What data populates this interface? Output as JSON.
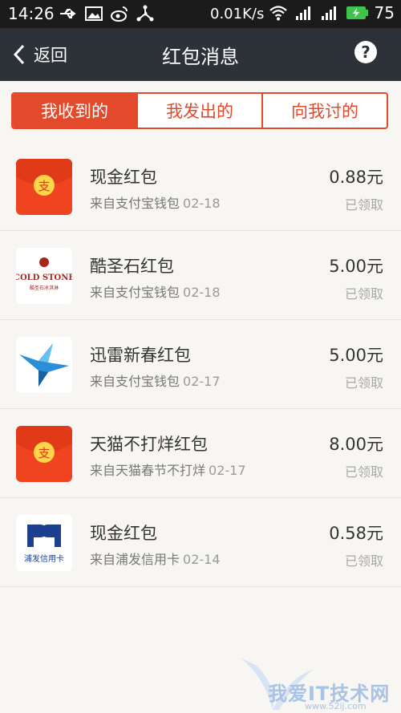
{
  "status_bar": {
    "time": "14:26",
    "speed": "0.01K/s",
    "battery": "75",
    "icons": [
      "usb-icon",
      "image-icon",
      "weibo-icon",
      "share-icon",
      "wifi-icon",
      "signal-icon",
      "battery-icon"
    ]
  },
  "nav": {
    "back_label": "返回",
    "title": "红包消息",
    "help_label": "?"
  },
  "tabs": [
    {
      "label": "我收到的",
      "active": true
    },
    {
      "label": "我发出的",
      "active": false
    },
    {
      "label": "向我讨的",
      "active": false
    }
  ],
  "items": [
    {
      "title": "现金红包",
      "source": "来自支付宝钱包",
      "date": "02-18",
      "amount": "0.88元",
      "status": "已领取",
      "icon": "alipay-redpacket-icon",
      "icon_char": "支"
    },
    {
      "title": "酷圣石红包",
      "source": "来自支付宝钱包",
      "date": "02-18",
      "amount": "5.00元",
      "status": "已领取",
      "icon": "coldstone-logo-icon",
      "logo_text": "COLD STONE",
      "logo_sub": "酷圣石冰淇淋"
    },
    {
      "title": "迅雷新春红包",
      "source": "来自支付宝钱包",
      "date": "02-17",
      "amount": "5.00元",
      "status": "已领取",
      "icon": "xunlei-bird-icon"
    },
    {
      "title": "天猫不打烊红包",
      "source": "来自天猫春节不打烊",
      "date": "02-17",
      "amount": "8.00元",
      "status": "已领取",
      "icon": "alipay-redpacket-icon",
      "icon_char": "支"
    },
    {
      "title": "现金红包",
      "source": "来自浦发信用卡",
      "date": "02-14",
      "amount": "0.58元",
      "status": "已领取",
      "icon": "spdb-logo-icon",
      "logo_text": "浦发信用卡"
    }
  ],
  "watermark": {
    "text": "我爱IT技术网",
    "url": "www.52ij.com"
  },
  "colors": {
    "accent": "#e24a2b",
    "navbar": "#2d3238",
    "statusbar": "#1b1b1b",
    "background": "#f8f6f2"
  }
}
